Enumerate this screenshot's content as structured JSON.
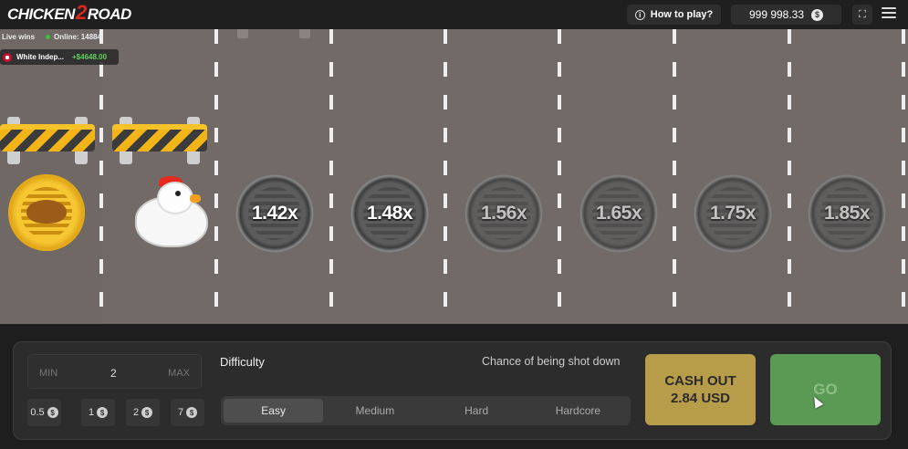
{
  "header": {
    "logo_text_left": "CHICKEN",
    "logo_text_mid": "2",
    "logo_text_right": "ROAD",
    "how_to_play": "How to play?",
    "balance": "999 998.33",
    "currency_symbol": "$"
  },
  "live": {
    "live_wins_label": "Live wins",
    "online_label": "Online: 14884",
    "win_player": "White Indep...",
    "win_amount": "+$4648.00"
  },
  "lanes": {
    "multipliers": [
      "1.42x",
      "1.48x",
      "1.56x",
      "1.65x",
      "1.75x",
      "1.85x"
    ]
  },
  "bet": {
    "min_label": "MIN",
    "value": "2",
    "max_label": "MAX",
    "chips": [
      "0.5",
      "1",
      "2",
      "7"
    ]
  },
  "difficulty": {
    "label": "Difficulty",
    "chance_label": "Chance of being shot down",
    "options": [
      "Easy",
      "Medium",
      "Hard",
      "Hardcore"
    ],
    "selected": "Easy"
  },
  "actions": {
    "cashout_line1": "CASH OUT",
    "cashout_line2": "2.84 USD",
    "go_label": "GO"
  },
  "colors": {
    "road": "#716a66",
    "cashout": "#b79c4a",
    "go": "#5a9a55",
    "win_green": "#5fd35f"
  }
}
